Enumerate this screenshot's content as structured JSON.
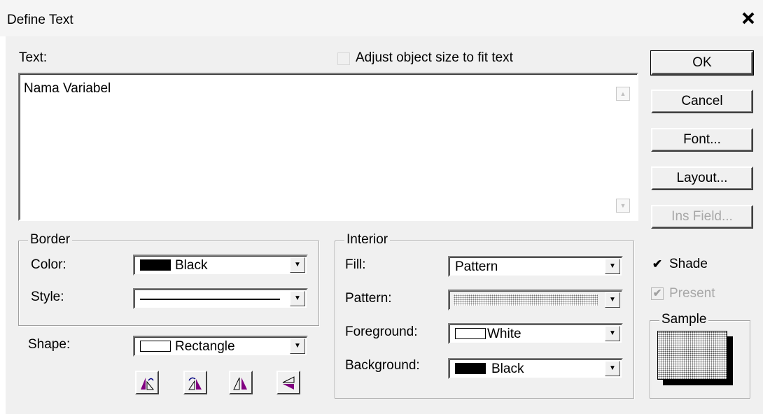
{
  "window": {
    "title": "Define Text",
    "close_glyph": "✕"
  },
  "text_section": {
    "label": "Text:",
    "adjust_checkbox_label": "Adjust object size to fit text",
    "adjust_checked": false,
    "content": "Nama Variabel"
  },
  "buttons": {
    "ok": "OK",
    "cancel": "Cancel",
    "font": "Font...",
    "layout": "Layout...",
    "ins_field": "Ins Field..."
  },
  "border": {
    "group_label": "Border",
    "color_label": "Color:",
    "color_value": "Black",
    "color_swatch": "#000000",
    "style_label": "Style:",
    "style_value": "solid-line"
  },
  "shape": {
    "label": "Shape:",
    "value": "Rectangle",
    "icons": [
      "rotate-left-icon",
      "rotate-right-icon",
      "flip-horizontal-icon",
      "flip-vertical-icon"
    ]
  },
  "interior": {
    "group_label": "Interior",
    "fill_label": "Fill:",
    "fill_value": "Pattern",
    "pattern_label": "Pattern:",
    "pattern_value": "dotted-pattern",
    "foreground_label": "Foreground:",
    "foreground_value": "White",
    "foreground_swatch": "#ffffff",
    "background_label": "Background:",
    "background_value": "Black",
    "background_swatch": "#000000"
  },
  "options": {
    "shade_label": "Shade",
    "shade_checked": true,
    "present_label": "Present",
    "present_checked": true,
    "present_disabled": true,
    "sample_label": "Sample"
  },
  "glyphs": {
    "check": "✔",
    "arrow_down": "▼",
    "arrow_up": "▲"
  }
}
